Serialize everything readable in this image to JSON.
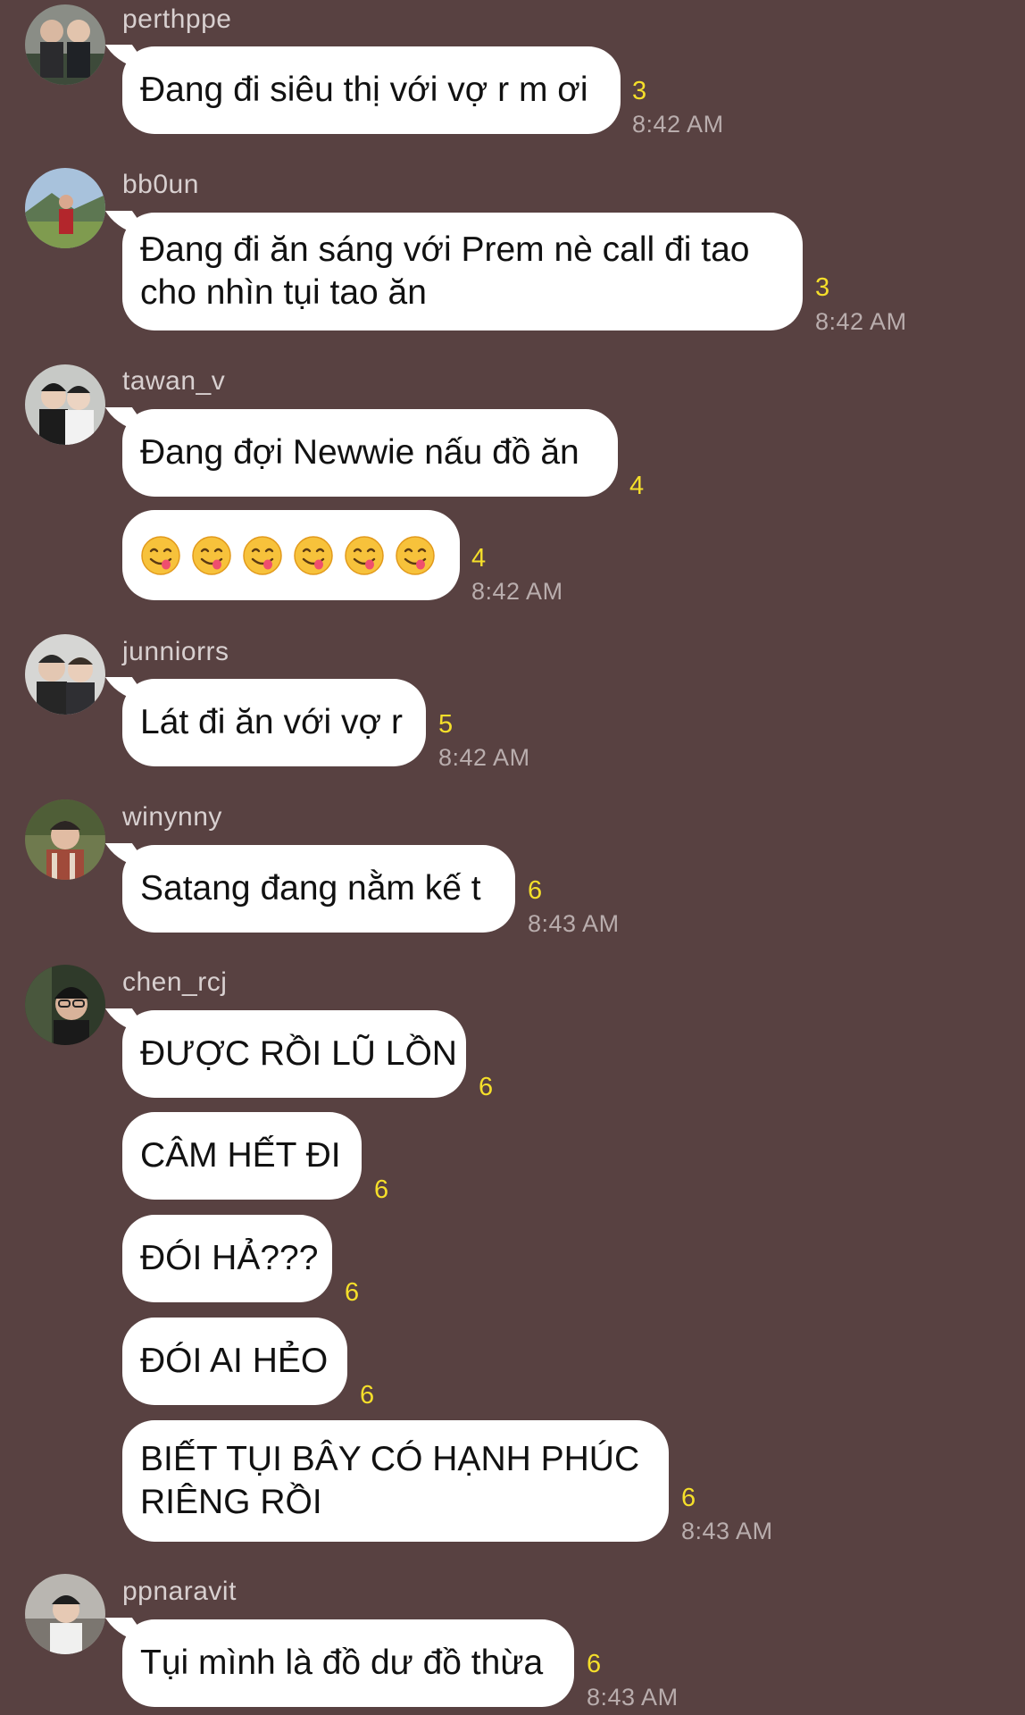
{
  "messages": [
    {
      "sender": "perthppe",
      "bubbles": [
        {
          "text": "Đang đi siêu thị với vợ r m ơi",
          "count": "3",
          "time": "8:42 AM"
        }
      ]
    },
    {
      "sender": "bb0un",
      "bubbles": [
        {
          "text": "Đang đi ăn sáng với Prem nè call đi tao cho nhìn tụi tao ăn",
          "count": "3",
          "time": "8:42 AM"
        }
      ]
    },
    {
      "sender": "tawan_v",
      "bubbles": [
        {
          "text": "Đang đợi Newwie nấu đồ ăn",
          "count": "4",
          "time": ""
        },
        {
          "text": "😋😋😋😋😋😋",
          "emoji_name": "face-savoring-food-emoji",
          "emoji_count": 6,
          "count": "4",
          "time": "8:42 AM"
        }
      ]
    },
    {
      "sender": "junniorrs",
      "bubbles": [
        {
          "text": "Lát đi ăn với vợ r",
          "count": "5",
          "time": "8:42 AM"
        }
      ]
    },
    {
      "sender": "winynny",
      "bubbles": [
        {
          "text": "Satang đang nằm kế t",
          "count": "6",
          "time": "8:43 AM"
        }
      ]
    },
    {
      "sender": "chen_rcj",
      "bubbles": [
        {
          "text": "ĐƯỢC RỒI LŨ LỒN",
          "count": "6",
          "time": ""
        },
        {
          "text": "CÂM HẾT ĐI",
          "count": "6",
          "time": ""
        },
        {
          "text": "ĐÓI HẢ???",
          "count": "6",
          "time": ""
        },
        {
          "text": "ĐÓI AI HẺO",
          "count": "6",
          "time": ""
        },
        {
          "text": "BIẾT TỤI BÂY CÓ HẠNH PHÚC RIÊNG RỒI",
          "count": "6",
          "time": "8:43 AM"
        }
      ]
    },
    {
      "sender": "ppnaravit",
      "bubbles": [
        {
          "text": "Tụi mình là đồ dư đồ thừa",
          "count": "6",
          "time": "8:43 AM"
        }
      ]
    }
  ],
  "colors": {
    "background": "#584141",
    "bubble": "#ffffff",
    "read_count": "#f5df2a",
    "timestamp": "#b9adad",
    "sender": "#d8d0d0"
  }
}
